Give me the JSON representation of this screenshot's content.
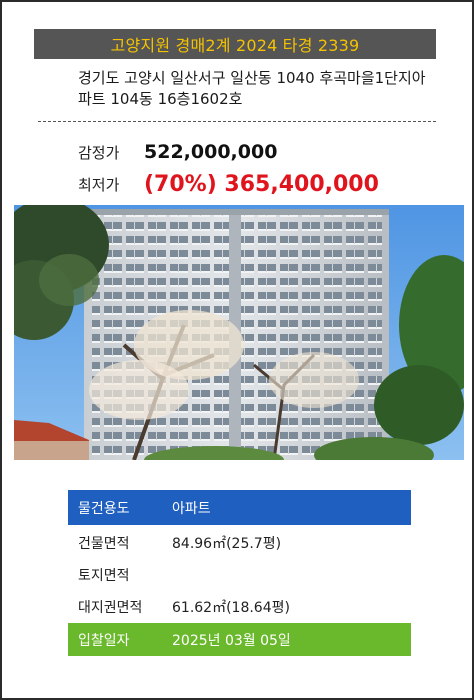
{
  "header": {
    "title": "고양지원 경매2계 2024 타경 2339"
  },
  "address": {
    "line1": "경기도 고양시 일산서구 일산동 1040 후곡마을1단지아",
    "line2": "파트 104동 16층1602호"
  },
  "prices": {
    "appraisal_label": "감정가",
    "appraisal_value": "522,000,000",
    "minimum_label": "최저가",
    "minimum_value": "(70%) 365,400,000"
  },
  "photo": {
    "icon": "apartment-building-photo"
  },
  "details": {
    "usage_label": "물건용도",
    "usage_value": "아파트",
    "building_area_label": "건물면적",
    "building_area_value": "84.96㎡(25.7평)",
    "land_area_label": "토지면적",
    "land_area_value": "",
    "land_right_label": "대지권면적",
    "land_right_value": "61.62㎡(18.64평)",
    "bid_date_label": "입찰일자",
    "bid_date_value": "2025년 03월 05일"
  },
  "colors": {
    "title_bg": "#555555",
    "title_text": "#f5c200",
    "minimum_price": "#e0141c",
    "usage_row": "#1f5fbf",
    "bid_row": "#6ab82b"
  }
}
